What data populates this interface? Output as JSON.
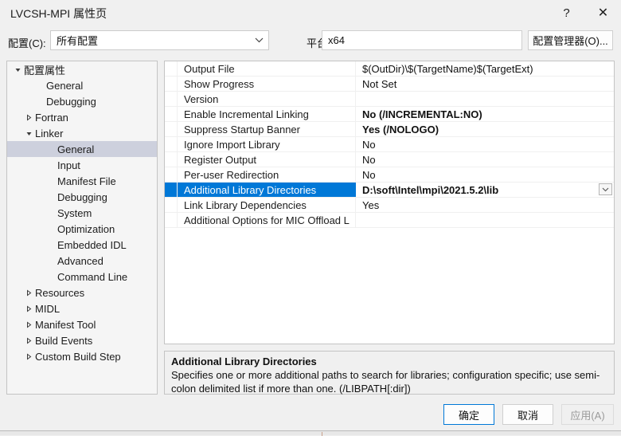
{
  "window": {
    "title": "LVCSH-MPI 属性页",
    "help_glyph": "?",
    "close_glyph": "✕"
  },
  "config_bar": {
    "config_label": "配置(C):",
    "config_value": "所有配置",
    "platform_label": "平台(P):",
    "platform_value": "x64",
    "config_manager_button": "配置管理器(O)..."
  },
  "tree": {
    "items": [
      {
        "label": "配置属性",
        "indent": 0,
        "expander": "expanded",
        "selected": false
      },
      {
        "label": "General",
        "indent": 2,
        "expander": "none",
        "selected": false
      },
      {
        "label": "Debugging",
        "indent": 2,
        "expander": "none",
        "selected": false
      },
      {
        "label": "Fortran",
        "indent": 1,
        "expander": "collapsed",
        "selected": false
      },
      {
        "label": "Linker",
        "indent": 1,
        "expander": "expanded",
        "selected": false
      },
      {
        "label": "General",
        "indent": 3,
        "expander": "none",
        "selected": true
      },
      {
        "label": "Input",
        "indent": 3,
        "expander": "none",
        "selected": false
      },
      {
        "label": "Manifest File",
        "indent": 3,
        "expander": "none",
        "selected": false
      },
      {
        "label": "Debugging",
        "indent": 3,
        "expander": "none",
        "selected": false
      },
      {
        "label": "System",
        "indent": 3,
        "expander": "none",
        "selected": false
      },
      {
        "label": "Optimization",
        "indent": 3,
        "expander": "none",
        "selected": false
      },
      {
        "label": "Embedded IDL",
        "indent": 3,
        "expander": "none",
        "selected": false
      },
      {
        "label": "Advanced",
        "indent": 3,
        "expander": "none",
        "selected": false
      },
      {
        "label": "Command Line",
        "indent": 3,
        "expander": "none",
        "selected": false
      },
      {
        "label": "Resources",
        "indent": 1,
        "expander": "collapsed",
        "selected": false
      },
      {
        "label": "MIDL",
        "indent": 1,
        "expander": "collapsed",
        "selected": false
      },
      {
        "label": "Manifest Tool",
        "indent": 1,
        "expander": "collapsed",
        "selected": false
      },
      {
        "label": "Build Events",
        "indent": 1,
        "expander": "collapsed",
        "selected": false
      },
      {
        "label": "Custom Build Step",
        "indent": 1,
        "expander": "collapsed",
        "selected": false
      }
    ]
  },
  "grid": {
    "rows": [
      {
        "name": "Output File",
        "value": "$(OutDir)\\$(TargetName)$(TargetExt)",
        "bold": false,
        "selected": false,
        "dropdown": false
      },
      {
        "name": "Show Progress",
        "value": "Not Set",
        "bold": false,
        "selected": false,
        "dropdown": false
      },
      {
        "name": "Version",
        "value": "",
        "bold": false,
        "selected": false,
        "dropdown": false
      },
      {
        "name": "Enable Incremental Linking",
        "value": "No (/INCREMENTAL:NO)",
        "bold": true,
        "selected": false,
        "dropdown": false
      },
      {
        "name": "Suppress Startup Banner",
        "value": "Yes (/NOLOGO)",
        "bold": true,
        "selected": false,
        "dropdown": false
      },
      {
        "name": "Ignore Import Library",
        "value": "No",
        "bold": false,
        "selected": false,
        "dropdown": false
      },
      {
        "name": "Register Output",
        "value": "No",
        "bold": false,
        "selected": false,
        "dropdown": false
      },
      {
        "name": "Per-user Redirection",
        "value": "No",
        "bold": false,
        "selected": false,
        "dropdown": false
      },
      {
        "name": "Additional Library Directories",
        "value": "D:\\soft\\Intel\\mpi\\2021.5.2\\lib",
        "bold": true,
        "selected": true,
        "dropdown": true
      },
      {
        "name": "Link Library Dependencies",
        "value": "Yes",
        "bold": false,
        "selected": false,
        "dropdown": false
      },
      {
        "name": "Additional Options for MIC Offload L",
        "value": "",
        "bold": false,
        "selected": false,
        "dropdown": false
      }
    ]
  },
  "description": {
    "title": "Additional Library Directories",
    "body": "Specifies one or more additional paths to search for libraries; configuration specific; use semi-colon delimited list if more than one. (/LIBPATH[:dir])"
  },
  "footer": {
    "ok": "确定",
    "cancel": "取消",
    "apply": "应用(A)"
  },
  "colors": {
    "accent": "#0078d7",
    "tree_selection": "#cdd0dd",
    "dialog_bg": "#f0f0f0"
  }
}
